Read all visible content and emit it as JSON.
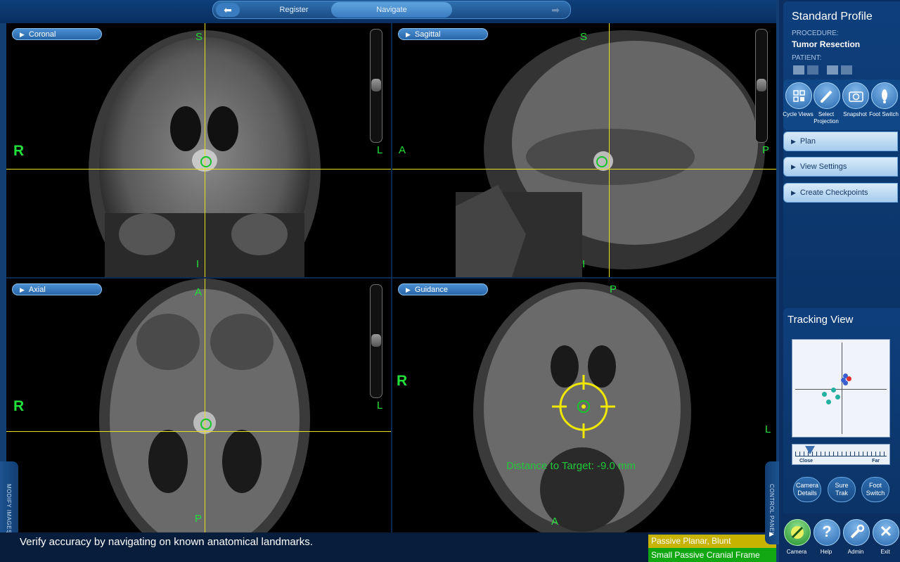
{
  "nav": {
    "back_icon": "arrow-left",
    "forward_icon": "arrow-right",
    "tabs": [
      {
        "label": "Register",
        "active": false
      },
      {
        "label": "Navigate",
        "active": true
      }
    ]
  },
  "viewports": {
    "coronal": {
      "label": "Coronal",
      "top": "S",
      "bottom": "I",
      "left": "R",
      "right": "L"
    },
    "sagittal": {
      "label": "Sagittal",
      "top": "S",
      "bottom": "I",
      "left": "A",
      "right": "P"
    },
    "axial": {
      "label": "Axial",
      "top": "A",
      "bottom": "P",
      "left": "R",
      "right": "L"
    },
    "guidance": {
      "label": "Guidance",
      "top": "P",
      "bottom": "A",
      "left": "R",
      "right": "L",
      "distance_text": "Distance to Target: -9.0 mm"
    }
  },
  "status": {
    "message": "Verify accuracy by navigating on known anatomical landmarks.",
    "instrument": "Passive Planar, Blunt",
    "reference": "Small Passive Cranial Frame",
    "instrument_color": "#c8b400",
    "reference_color": "#12a814"
  },
  "left_tab": {
    "label": "MODIFY IMAGES"
  },
  "right_tab": {
    "label": "CONTROL PANEL"
  },
  "panel": {
    "title": "Standard Profile",
    "procedure_label": "PROCEDURE:",
    "procedure_value": "Tumor Resection",
    "patient_label": "PATIENT:",
    "buttons": [
      {
        "label": "Cycle Views",
        "icon": "cycle-views-icon"
      },
      {
        "label": "Select Projection",
        "icon": "pen-icon"
      },
      {
        "label": "Snapshot",
        "icon": "camera-icon"
      },
      {
        "label": "Foot Switch",
        "icon": "foot-icon"
      }
    ],
    "accordions": [
      "Plan",
      "View Settings",
      "Create Checkpoints"
    ]
  },
  "tracking": {
    "title": "Tracking View",
    "scale_close": "Close",
    "scale_far": "Far",
    "buttons": [
      "Camera Details",
      "Sure Trak",
      "Foot Switch"
    ]
  },
  "bottom_buttons": [
    {
      "label": "Camera",
      "icon": "camera-tool-icon"
    },
    {
      "label": "Help",
      "icon": "?"
    },
    {
      "label": "Admin",
      "icon": "wrench-icon"
    },
    {
      "label": "Exit",
      "icon": "✕"
    }
  ]
}
